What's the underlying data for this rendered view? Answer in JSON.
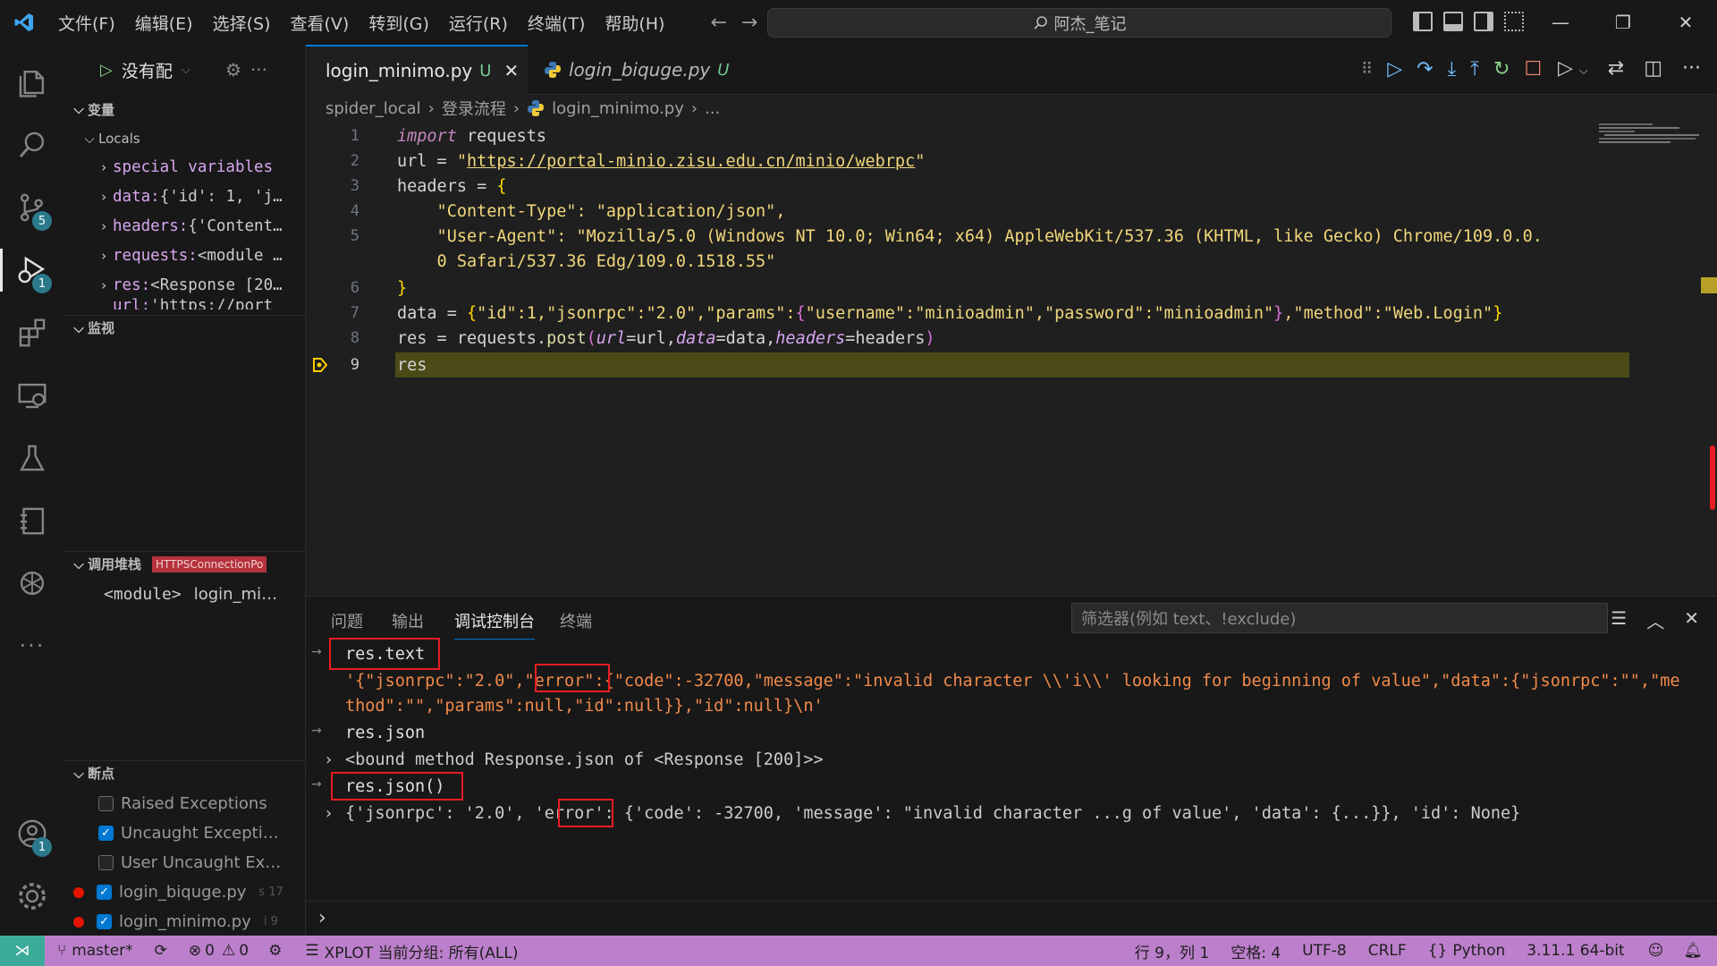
{
  "titlebar": {
    "menu": [
      "文件(F)",
      "编辑(E)",
      "选择(S)",
      "查看(V)",
      "转到(G)",
      "运行(R)",
      "终端(T)",
      "帮助(H)"
    ],
    "search_text": "阿杰_笔记"
  },
  "activity": {
    "scm_badge": "5",
    "debug_badge": "1",
    "account_badge": "1"
  },
  "sidebar": {
    "run_config": "没有配",
    "variables_title": "变量",
    "locals_title": "Locals",
    "locals": [
      {
        "name": "special variables",
        "value": ""
      },
      {
        "name": "data:",
        "value": " {'id': 1, 'j…"
      },
      {
        "name": "headers:",
        "value": " {'Content…"
      },
      {
        "name": "requests:",
        "value": " <module …"
      },
      {
        "name": "res:",
        "value": " <Response [20…"
      },
      {
        "name": "url:",
        "value": " 'https://port"
      }
    ],
    "watch_title": "监视",
    "callstack_title": "调用堆栈",
    "callstack_label": "HTTPSConnectionPo",
    "callstack_frame_name": "<module>",
    "callstack_frame_file": "login_mi…",
    "breakpoints_title": "断点",
    "breakpoints": [
      {
        "label": "Raised Exceptions",
        "checked": false,
        "dot": false,
        "line": ""
      },
      {
        "label": "Uncaught Excepti…",
        "checked": true,
        "dot": false,
        "line": ""
      },
      {
        "label": "User Uncaught Ex…",
        "checked": false,
        "dot": false,
        "line": ""
      },
      {
        "label": "login_biquge.py",
        "checked": true,
        "dot": true,
        "line": "s 17"
      },
      {
        "label": "login_minimo.py",
        "checked": true,
        "dot": true,
        "line": "i 9"
      }
    ]
  },
  "tabs": [
    {
      "label": "login_minimo.py",
      "status": "U",
      "active": true
    },
    {
      "label": "login_biquge.py",
      "status": "U",
      "active": false
    }
  ],
  "breadcrumb": [
    "spider_local",
    "登录流程",
    "login_minimo.py",
    "..."
  ],
  "editor": {
    "line_numbers": [
      "1",
      "2",
      "3",
      "4",
      "5",
      "",
      "6",
      "7",
      "8",
      "9"
    ],
    "lines": {
      "l1_kw": "import",
      "l1_rest": " requests",
      "l2_a": "url = ",
      "l2_q1": "\"",
      "l2_url": "https://portal-minio.zisu.edu.cn/minio/webrpc",
      "l2_q2": "\"",
      "l3_a": "headers = ",
      "l3_b": "{",
      "l4": "    \"Content-Type\": \"application/json\",",
      "l5": "    \"User-Agent\": \"Mozilla/5.0 (Windows NT 10.0; Win64; x64) AppleWebKit/537.36 (KHTML, like Gecko) Chrome/109.0.0.",
      "l5b": "    0 Safari/537.36 Edg/109.0.1518.55\"",
      "l6": "}",
      "l7_a": "data = ",
      "l7_b": "{",
      "l7_c": "\"id\":1,\"jsonrpc\":\"2.0\",\"params\":",
      "l7_d": "{",
      "l7_e": "\"username\":\"minioadmin\",\"password\":\"minioadmin\"",
      "l7_f": "}",
      "l7_g": ",\"method\":\"Web.Login\"",
      "l7_h": "}",
      "l8_a": "res = requests.",
      "l8_fn": "post",
      "l8_p1": "(",
      "l8_k1": "url",
      "l8_v1": "=url,",
      "l8_k2": "data",
      "l8_v2": "=data,",
      "l8_k3": "headers",
      "l8_v3": "=headers",
      "l8_p2": ")",
      "l9": "res"
    }
  },
  "panel": {
    "tabs": [
      "问题",
      "输出",
      "调试控制台",
      "终端"
    ],
    "filter_placeholder": "筛选器(例如 text、!exclude)",
    "console": {
      "c1": "res.text",
      "c2": "'{\"jsonrpc\":\"2.0\",\"error\":{\"code\":-32700,\"message\":\"invalid character \\\\'i\\\\' looking for beginning of value\",\"data\":{\"jsonrpc\":\"\",\"me",
      "c3": "thod\":\"\",\"params\":null,\"id\":null}},\"id\":null}\\n'",
      "c4": "res.json",
      "c5": "<bound method Response.json of <Response [200]>>",
      "c6": "res.json()",
      "c7": "{'jsonrpc': '2.0', 'error': {'code': -32700, 'message': \"invalid character ...g of value', 'data': {...}}, 'id': None}"
    }
  },
  "statusbar": {
    "branch": "master*",
    "errors": "0",
    "warnings": "0",
    "xplot": "XPLOT 当前分组: 所有(ALL)",
    "position": "行 9，列 1",
    "spaces": "空格: 4",
    "encoding": "UTF-8",
    "eol": "CRLF",
    "language": "Python",
    "interpreter": "3.11.1 64-bit"
  },
  "colors": {
    "statusbar": "#bc7fcb",
    "current_line": "#4b4b18",
    "console_output": "#f18a4a",
    "highlight_box": "#e81c24"
  }
}
